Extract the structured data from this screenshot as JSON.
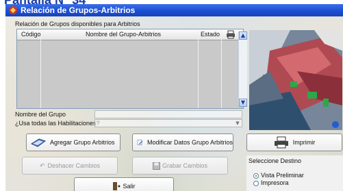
{
  "caption": "Pantalla N° 34",
  "window": {
    "title": "Relación de Grupos-Arbitrios"
  },
  "groups_list": {
    "label": "Relación de Grupos disponibles para Arbitrios",
    "columns": [
      "Código",
      "Nombre del Grupo-Arbitrios",
      "Estado"
    ],
    "rows": []
  },
  "form": {
    "group_name_label": "Nombre del Grupo",
    "group_name_value": "",
    "use_all_label": "¿Usa todas las Habilitaciones?",
    "use_all_value": ""
  },
  "buttons": {
    "add": "Agregar Grupo Arbitrios",
    "modify": "Modificar Datos Grupo Arbitrios",
    "print": "Imprimir",
    "undo": "Deshacer Cambios",
    "save": "Grabar Cambios",
    "exit": "Salir"
  },
  "destination": {
    "title": "Seleccione Destino",
    "options": [
      "Vista Preliminar",
      "Impresora"
    ],
    "selected": "Vista Preliminar"
  },
  "colors": {
    "titlebar": "#1c4fd1",
    "accent": "#1d8c1d"
  }
}
